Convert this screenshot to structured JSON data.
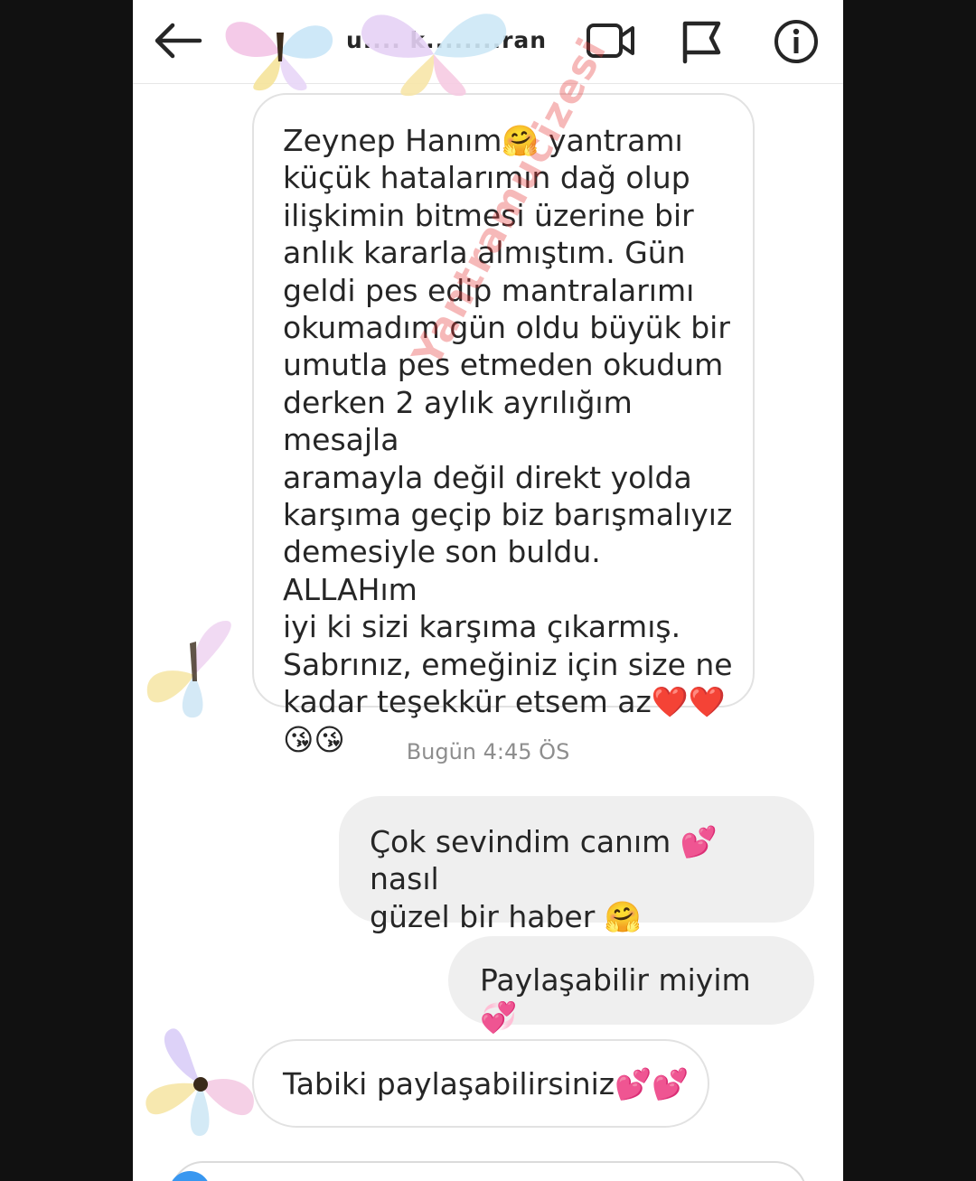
{
  "header": {
    "title": "u.... k........ran",
    "icons": [
      "back-arrow-icon",
      "video-call-icon",
      "flag-icon",
      "info-icon"
    ]
  },
  "messages": [
    {
      "side": "incoming",
      "text": "Zeynep Hanım🤗 yantramı\nküçük hatalarımın dağ olup\nilişkimin bitmesi üzerine bir\nanlık kararla almıştım. Gün\ngeldi pes edip mantralarımı\nokumadım gün oldu büyük bir\numutla pes etmeden okudum\nderken 2 aylık ayrılığım mesajla\naramayla değil direkt yolda\nkarşıma geçip biz barışmalıyız\ndemesiyle son buldu. ALLAHım\niyi ki sizi karşıma çıkarmış.\nSabrınız, emeğiniz için size ne\nkadar teşekkür etsem az❤️❤️\n😘😘"
    },
    {
      "side": "outgoing",
      "text": "Çok sevindim canım 💕 nasıl\ngüzel bir haber 🤗"
    },
    {
      "side": "outgoing",
      "text": "Paylaşabilir miyim 💞"
    },
    {
      "side": "incoming",
      "text": "Tabiki paylaşabilirsiniz💕💕"
    }
  ],
  "timestamp": "Bugün 4:45 ÖS",
  "watermark": "Yantramucizesi",
  "colors": {
    "accent": "#3897f0",
    "outgoing_bubble": "#efefef",
    "watermark": "#e83a3a"
  }
}
